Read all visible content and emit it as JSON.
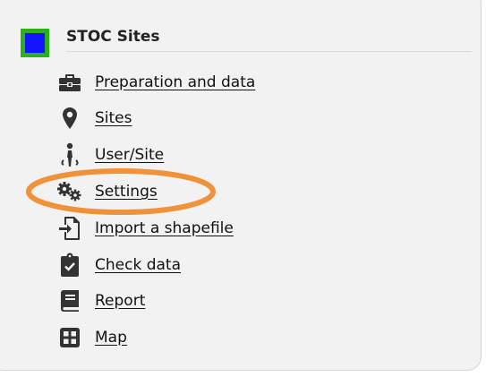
{
  "section": {
    "title": "STOC Sites",
    "marker_colors": {
      "border": "#2db11a",
      "fill": "#1414ff"
    }
  },
  "menu": {
    "items": [
      {
        "label": "Preparation and data",
        "icon": "briefcase-icon"
      },
      {
        "label": "Sites",
        "icon": "map-pin-icon"
      },
      {
        "label": "User/Site",
        "icon": "person-walking-icon"
      },
      {
        "label": "Settings",
        "icon": "gears-icon"
      },
      {
        "label": "Import a shapefile",
        "icon": "file-import-icon"
      },
      {
        "label": "Check data",
        "icon": "clipboard-check-icon"
      },
      {
        "label": "Report",
        "icon": "book-icon"
      },
      {
        "label": "Map",
        "icon": "grid-map-icon"
      }
    ]
  },
  "annotation": {
    "highlight_color": "#f0923a",
    "highlighted_item": "Settings"
  }
}
